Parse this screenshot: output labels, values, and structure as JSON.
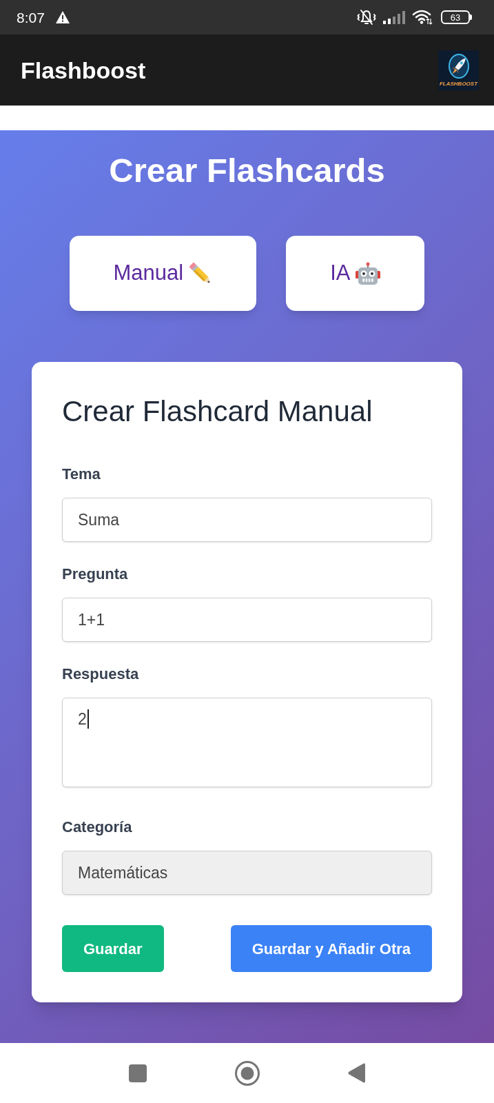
{
  "status_bar": {
    "time": "8:07",
    "battery": "63"
  },
  "app_bar": {
    "title": "Flashboost",
    "logo_text": "FLASHBOOST"
  },
  "page": {
    "title": "Crear Flashcards",
    "modes": [
      {
        "kind": "manual",
        "label": "Manual"
      },
      {
        "kind": "ai",
        "label": "IA"
      }
    ]
  },
  "form": {
    "title": "Crear Flashcard Manual",
    "fields": [
      {
        "kind": "input",
        "label": "Tema",
        "value": "Suma",
        "disabled": false,
        "focused": false
      },
      {
        "kind": "input",
        "label": "Pregunta",
        "value": "1+1",
        "disabled": false,
        "focused": false
      },
      {
        "kind": "textarea",
        "label": "Respuesta",
        "value": "2",
        "disabled": false,
        "focused": true
      },
      {
        "kind": "select",
        "label": "Categoría",
        "value": "Matemáticas",
        "disabled": true,
        "focused": false
      }
    ],
    "buttons": [
      {
        "kind": "primary",
        "label": "Guardar"
      },
      {
        "kind": "secondary",
        "label": "Guardar y Añadir Otra"
      }
    ]
  }
}
